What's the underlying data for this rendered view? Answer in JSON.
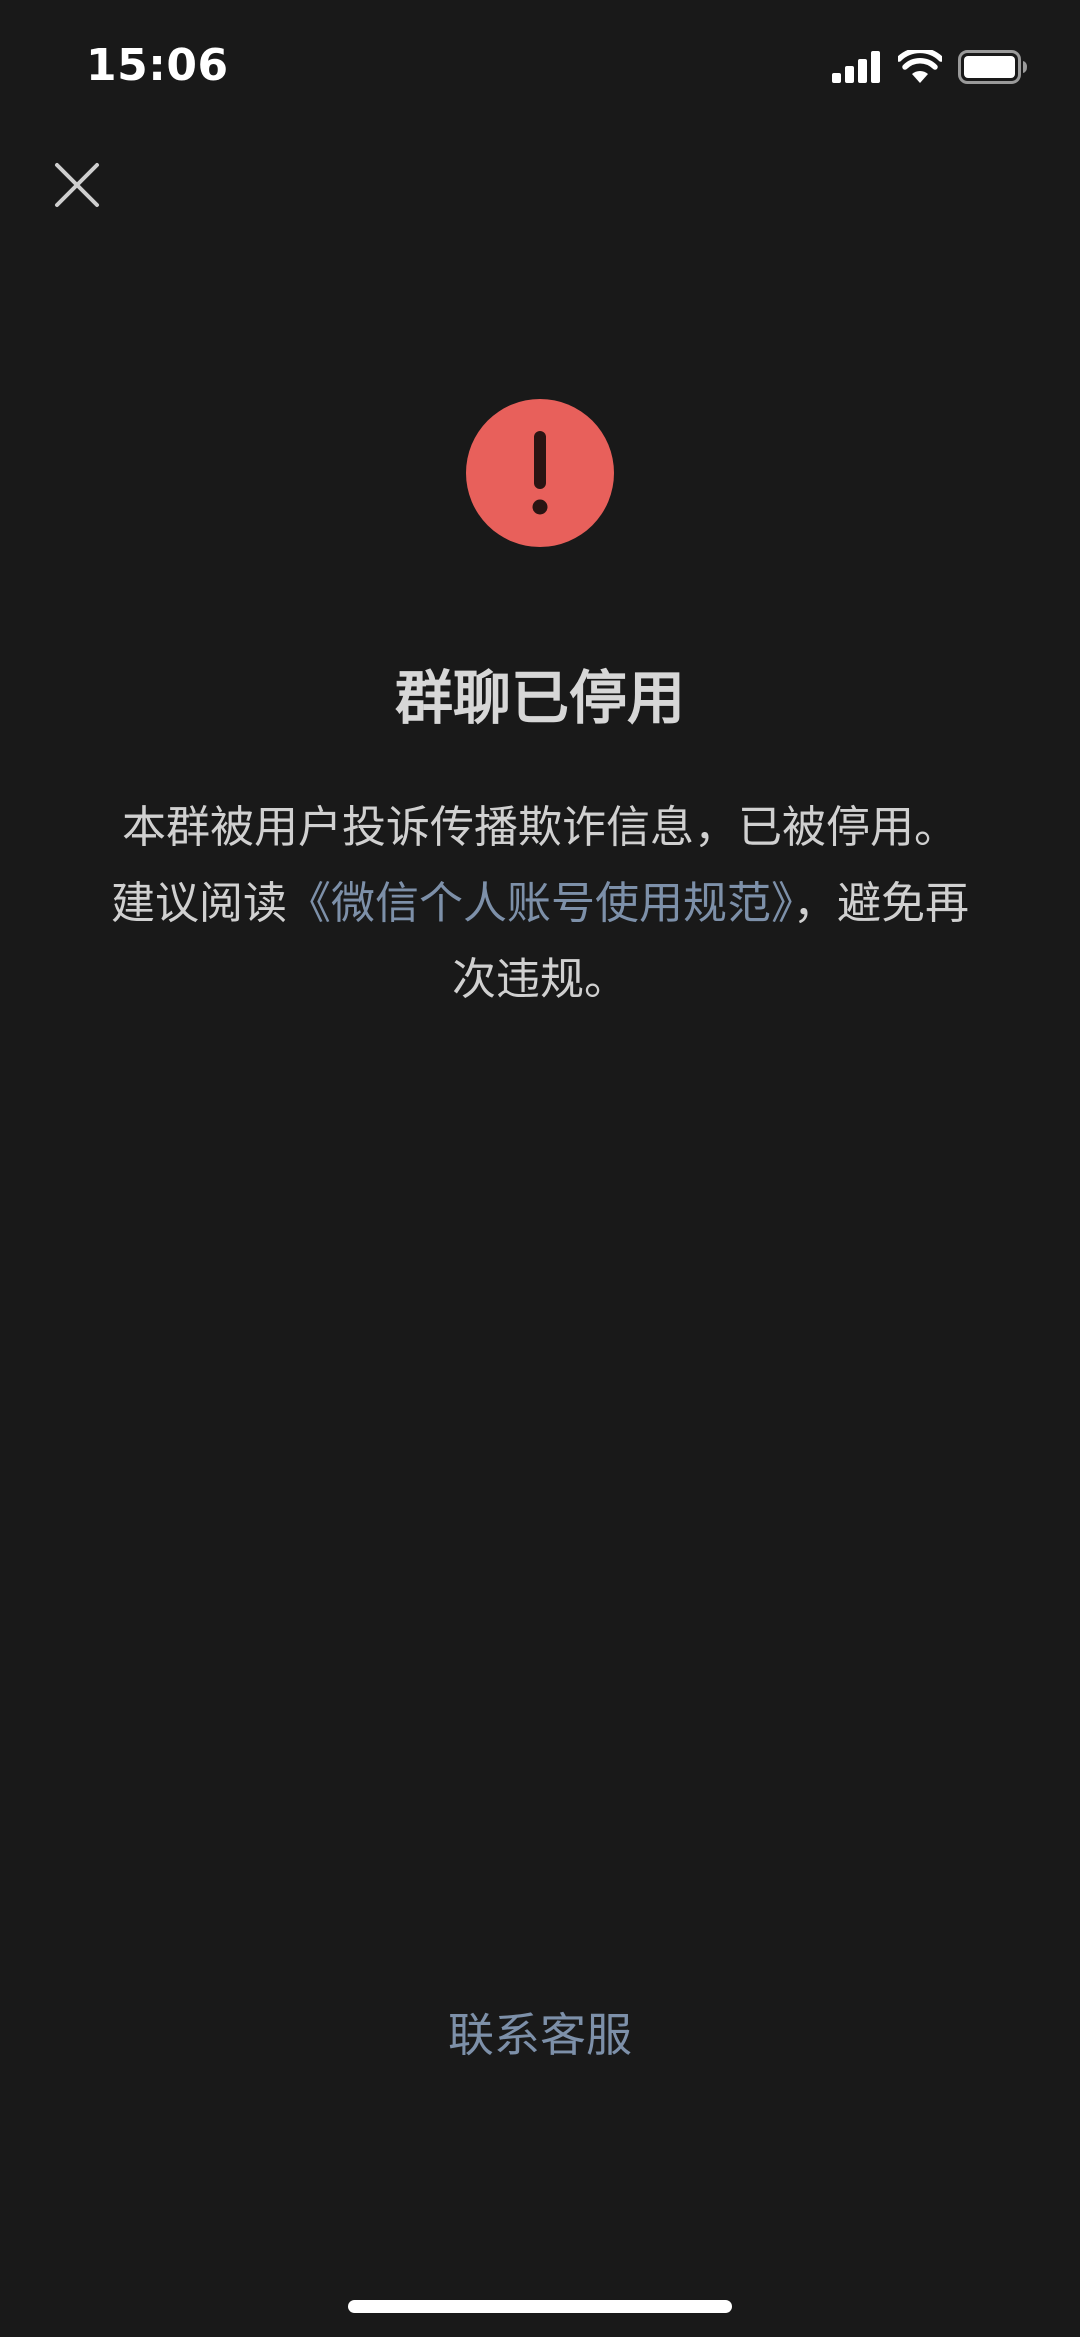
{
  "status_bar": {
    "time": "15:06",
    "icons": [
      "cellular-signal-icon",
      "wifi-icon",
      "battery-icon"
    ]
  },
  "header": {
    "close_icon": "close-icon"
  },
  "alert": {
    "icon": "exclamation-icon",
    "color": "#e8605b"
  },
  "content": {
    "title": "群聊已停用",
    "description_prefix": "本群被用户投诉传播欺诈信息，已被停用。 建议阅读",
    "rules_link": "《微信个人账号使用规范》",
    "description_suffix": "，避免再次违规。"
  },
  "footer": {
    "contact_support": "联系客服"
  },
  "colors": {
    "background": "#191919",
    "link": "#7d90a9",
    "text": "#d0d0d0"
  }
}
